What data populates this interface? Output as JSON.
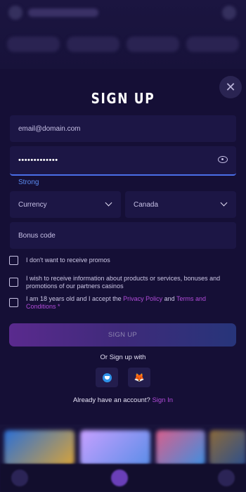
{
  "modal": {
    "title": "SIGN UP",
    "close_icon": "close-icon",
    "close_glyph": "✕"
  },
  "form": {
    "email_value": "email@domain.com",
    "password_value": "•••••••••••••",
    "password_strength": "Strong",
    "currency_value": "Currency",
    "country_value": "Canada",
    "bonus_placeholder": "Bonus code"
  },
  "checkboxes": {
    "no_promos": "I don't want to receive promos",
    "partners": "I wish to receive information about products or services, bonuses and promotions of our partners casinos",
    "age_prefix": "I am 18 years old and I accept the ",
    "privacy_link": "Privacy Policy",
    "and": " and ",
    "terms_link": "Terms and Conditions",
    "required_mark": " *"
  },
  "actions": {
    "signup_label": "SIGN UP",
    "or_text": "Or Sign up with",
    "twitter_icon": "twitter-icon",
    "metamask_icon": "metamask-icon",
    "metamask_glyph": "🦊",
    "account_prompt": "Already have an account? ",
    "signin_link": "Sign In"
  },
  "colors": {
    "accent_blue": "#4a6ee8",
    "link_purple": "#b04bd8",
    "modal_bg": "#150f36"
  }
}
